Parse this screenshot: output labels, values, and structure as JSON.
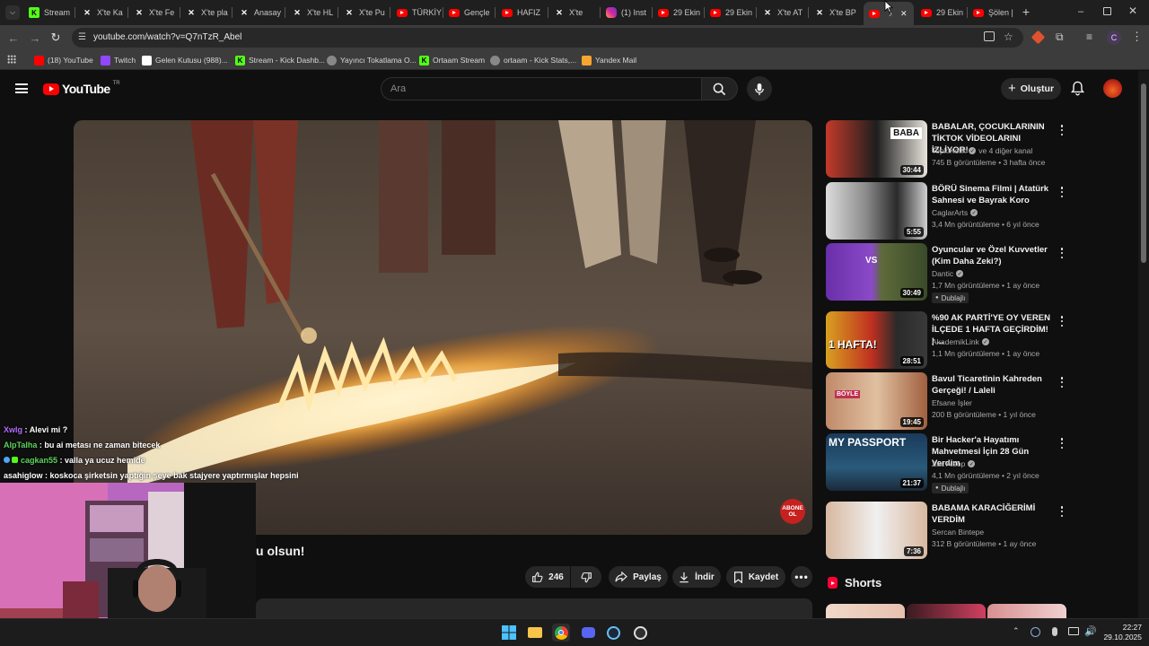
{
  "browser": {
    "tabs": [
      {
        "label": "Stream",
        "icon": "kick-icon",
        "active": false
      },
      {
        "label": "X'te Ka",
        "icon": "x-icon",
        "active": false
      },
      {
        "label": "X'te Fe",
        "icon": "x-icon",
        "active": false
      },
      {
        "label": "X'te pla",
        "icon": "x-icon",
        "active": false
      },
      {
        "label": "Anasay",
        "icon": "x-icon",
        "active": false
      },
      {
        "label": "X'te HL",
        "icon": "x-icon",
        "active": false
      },
      {
        "label": "X'te Pu",
        "icon": "x-icon",
        "active": false
      },
      {
        "label": "TÜRKİY",
        "icon": "youtube-icon",
        "active": false
      },
      {
        "label": "Gençle",
        "icon": "youtube-icon",
        "active": false
      },
      {
        "label": "HAFIZ",
        "icon": "youtube-icon",
        "active": false
      },
      {
        "label": "X'te",
        "icon": "x-icon",
        "active": false
      },
      {
        "label": "(1) Inst",
        "icon": "instagram-icon",
        "active": false
      },
      {
        "label": "29 Ekin",
        "icon": "youtube-icon",
        "active": false
      },
      {
        "label": "29 Ekin",
        "icon": "youtube-icon",
        "active": false
      },
      {
        "label": "X'te AT",
        "icon": "x-icon",
        "active": false
      },
      {
        "label": "X'te BP",
        "icon": "x-icon",
        "active": false
      },
      {
        "label": "",
        "icon": "youtube-icon",
        "active": true
      },
      {
        "label": "29 Ekin",
        "icon": "youtube-icon",
        "active": false
      },
      {
        "label": "Şölen |",
        "icon": "youtube-icon",
        "active": false
      }
    ],
    "url": "youtube.com/watch?v=Q7nTzR_Abel",
    "bookmarks": [
      {
        "label": "(18) YouTube",
        "icon": "youtube-icon"
      },
      {
        "label": "Twitch",
        "icon": "twitch-icon"
      },
      {
        "label": "Gelen Kutusu (988)...",
        "icon": "gmail-icon"
      },
      {
        "label": "Stream - Kick Dashb...",
        "icon": "kick-icon"
      },
      {
        "label": "Yayıncı Tokatlama O...",
        "icon": "globe-icon"
      },
      {
        "label": "Ortaam Stream",
        "icon": "kick-icon"
      },
      {
        "label": "ortaam - Kick Stats,...",
        "icon": "globe-icon"
      },
      {
        "label": "Yandex Mail",
        "icon": "mail-icon"
      }
    ],
    "profile_initial": "C"
  },
  "youtube": {
    "logo_text": "YouTube",
    "logo_region": "TR",
    "search_placeholder": "Ara",
    "create_label": "Oluştur",
    "video": {
      "title_fragment": "u olsun!",
      "subscribe_badge": "ABONE OL",
      "likes": "246",
      "share_label": "Paylaş",
      "download_label": "İndir",
      "save_label": "Kaydet"
    },
    "chat": [
      {
        "user": "Xwlg",
        "msg": "Alevi mi ?",
        "color": "#b56cff"
      },
      {
        "user": "AlpTalha",
        "msg": "bu ai metası ne zaman bitecek",
        "color": "#5bd45b"
      },
      {
        "user": "cagkan55",
        "msg": "valla ya ucuz hemide",
        "color": "#5bd45b"
      },
      {
        "user": "asahiglow",
        "msg": "koskoca şirketsin yaptığın şeye bak stajyere yaptırmışlar hepsini",
        "color": "#ffffff"
      }
    ],
    "recommendations": [
      {
        "title": "BABALAR, ÇOCUKLARININ TİKTOK VİDEOLARINI İZLİYOR!",
        "channel": "TepkiKolik",
        "channel_extra": "ve 4 diğer kanal",
        "verified": true,
        "meta": "745 B görüntüleme • 3 hafta önce",
        "duration": "30:44",
        "badge": "",
        "thumb_text": "BABA"
      },
      {
        "title": "BÖRÜ Sinema Filmi | Atatürk Sahnesi ve Bayrak Koro",
        "channel": "CaglarArts",
        "channel_extra": "",
        "verified": true,
        "meta": "3,4 Mn görüntüleme • 6 yıl önce",
        "duration": "5:55",
        "badge": "",
        "thumb_text": ""
      },
      {
        "title": "Oyuncular ve Özel Kuvvetler (Kim Daha Zeki?)",
        "channel": "Dantic",
        "channel_extra": "",
        "verified": true,
        "meta": "1,7 Mn görüntüleme • 1 ay önce",
        "duration": "30:49",
        "badge": "Dublajlı",
        "thumb_text": "VS"
      },
      {
        "title": "%90 AK PARTİ'YE OY VEREN İLÇEDE 1 HAFTA GEÇİRDİM! | ...",
        "channel": "AkademikLink",
        "channel_extra": "",
        "verified": true,
        "meta": "1,1 Mn görüntüleme • 1 ay önce",
        "duration": "28:51",
        "badge": "",
        "thumb_text": "1 HAFTA!"
      },
      {
        "title": "Bavul Ticaretinin Kahreden Gerçeği! / Laleli",
        "channel": "Efsane İşler",
        "channel_extra": "",
        "verified": false,
        "meta": "200 B görüntüleme • 1 yıl önce",
        "duration": "19:45",
        "badge": "",
        "thumb_text": "BÖYLE"
      },
      {
        "title": "Bir Hacker'a Hayatımı Mahvetmesi İçin 28 Gün Verdim",
        "channel": "Zac Alsop",
        "channel_extra": "",
        "verified": true,
        "meta": "4,1 Mn görüntüleme • 2 yıl önce",
        "duration": "21:37",
        "badge": "Dublajlı",
        "thumb_text": "MY PASSPORT"
      },
      {
        "title": "BABAMA KARACİĞERİMİ VERDİM",
        "channel": "Sercan Bintepe",
        "channel_extra": "",
        "verified": false,
        "meta": "312 B görüntüleme • 1 ay önce",
        "duration": "7:36",
        "badge": "",
        "thumb_text": ""
      }
    ],
    "shorts_label": "Shorts"
  },
  "taskbar": {
    "time": "22:27",
    "date": "29.10.2025"
  }
}
